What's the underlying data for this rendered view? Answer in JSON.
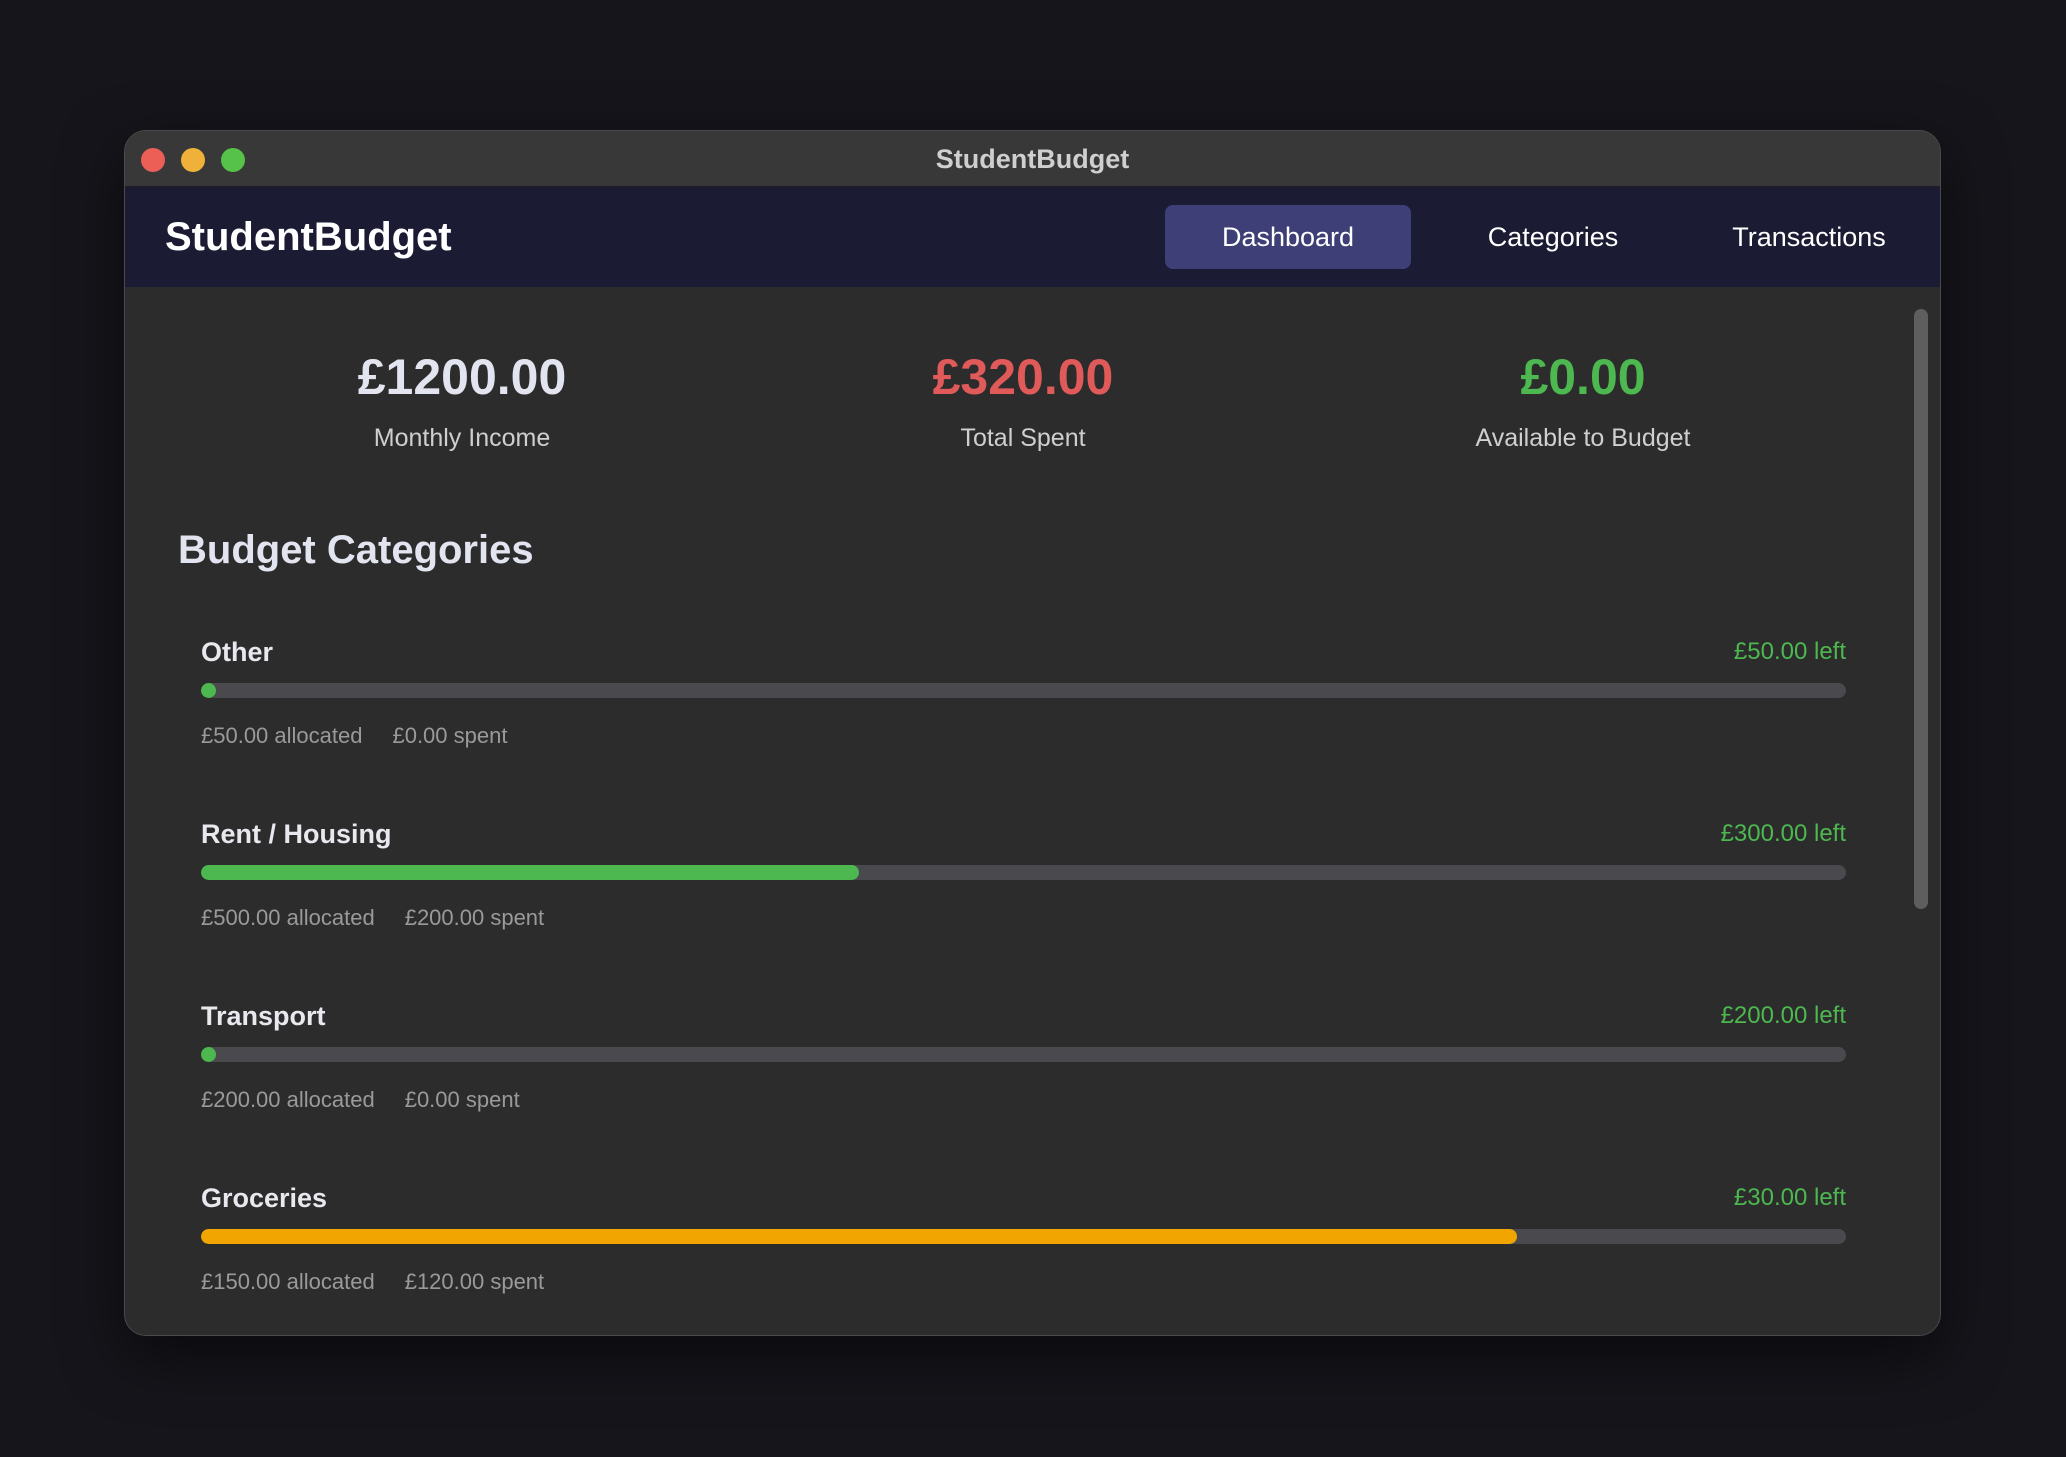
{
  "window": {
    "title": "StudentBudget"
  },
  "navbar": {
    "brand": "StudentBudget",
    "tabs": [
      {
        "label": "Dashboard",
        "active": true
      },
      {
        "label": "Categories",
        "active": false
      },
      {
        "label": "Transactions",
        "active": false
      }
    ]
  },
  "stats": [
    {
      "value": "£1200.00",
      "label": "Monthly Income",
      "color": "#e2e4ef"
    },
    {
      "value": "£320.00",
      "label": "Total Spent",
      "color": "#e05a5a"
    },
    {
      "value": "£0.00",
      "label": "Available to Budget",
      "color": "#4cb84f"
    }
  ],
  "section": {
    "title": "Budget Categories"
  },
  "categories": [
    {
      "name": "Other",
      "left": "£50.00 left",
      "allocated": "£50.00 allocated",
      "spent": "£0.00 spent",
      "progress": 0.0,
      "bar_color": "#4cb84f",
      "left_color": "#4cb84f"
    },
    {
      "name": "Rent / Housing",
      "left": "£300.00 left",
      "allocated": "£500.00 allocated",
      "spent": "£200.00 spent",
      "progress": 0.4,
      "bar_color": "#4cb84f",
      "left_color": "#4cb84f"
    },
    {
      "name": "Transport",
      "left": "£200.00 left",
      "allocated": "£200.00 allocated",
      "spent": "£0.00 spent",
      "progress": 0.0,
      "bar_color": "#4cb84f",
      "left_color": "#4cb84f"
    },
    {
      "name": "Groceries",
      "left": "£30.00 left",
      "allocated": "£150.00 allocated",
      "spent": "£120.00 spent",
      "progress": 0.8,
      "bar_color": "#f0a500",
      "left_color": "#4cb84f"
    }
  ]
}
